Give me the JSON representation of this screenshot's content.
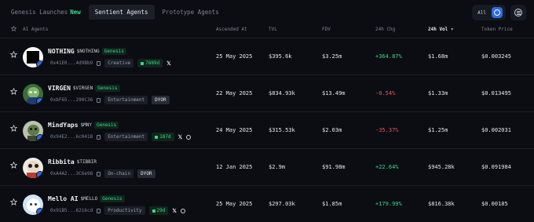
{
  "tabs": [
    {
      "label": "Genesis Launches",
      "badge": "New"
    },
    {
      "label": "Sentient Agents"
    },
    {
      "label": "Prototype Agents"
    }
  ],
  "filter": {
    "all_label": "All"
  },
  "columns": {
    "agent": "AI Agents",
    "ascended": "Ascended At",
    "tvl": "TVL",
    "fdv": "FDV",
    "chg": "24h Chg",
    "vol": "24h Vol",
    "price": "Token Price"
  },
  "colors": {
    "accent": "#2e6be6",
    "positive": "#39d98a",
    "negative": "#f0535a"
  },
  "rows": [
    {
      "name": "NOTHING",
      "ticker": "$NOTHING",
      "genesis": "Genesis",
      "address": "0x41E0...4d9Bb9",
      "category": "Creative",
      "lock": "7889d",
      "ascended": "25 May 2025",
      "tvl": "$395.6k",
      "fdv": "$3.25m",
      "chg": "+364.87%",
      "vol": "$1.68m",
      "price": "$0.003245"
    },
    {
      "name": "VIRGEN",
      "ticker": "$VIRGEN",
      "genesis": "Genesis",
      "address": "0xbF65...290C36",
      "category": "Entertainment",
      "dyor": "DYOR",
      "ascended": "22 May 2025",
      "tvl": "$834.93k",
      "fdv": "$13.49m",
      "chg": "-0.54%",
      "vol": "$1.33m",
      "price": "$0.013495"
    },
    {
      "name": "MindYaps",
      "ticker": "$MNY",
      "genesis": "Genesis",
      "address": "0x94E2...6c0418",
      "category": "Entertainment",
      "lock": "187d",
      "ascended": "24 May 2025",
      "tvl": "$315.53k",
      "fdv": "$2.03m",
      "chg": "-35.37%",
      "vol": "$1.25m",
      "price": "$0.002031"
    },
    {
      "name": "Ribbita",
      "ticker": "$TIBBIR",
      "address": "0xA4A2...3C6e98",
      "category": "On-chain",
      "dyor": "DYOR",
      "ascended": "12 Jan 2025",
      "tvl": "$2.9m",
      "fdv": "$91.98m",
      "chg": "+22.64%",
      "vol": "$945.28k",
      "price": "$0.091984"
    },
    {
      "name": "Mello AI",
      "ticker": "$MELLO",
      "genesis": "Genesis",
      "address": "0x91B5...6216cd",
      "category": "Productivity",
      "lock": "29d",
      "ascended": "25 May 2025",
      "tvl": "$297.03k",
      "fdv": "$1.85m",
      "chg": "+179.99%",
      "vol": "$816.38k",
      "price": "$0.00185"
    }
  ]
}
